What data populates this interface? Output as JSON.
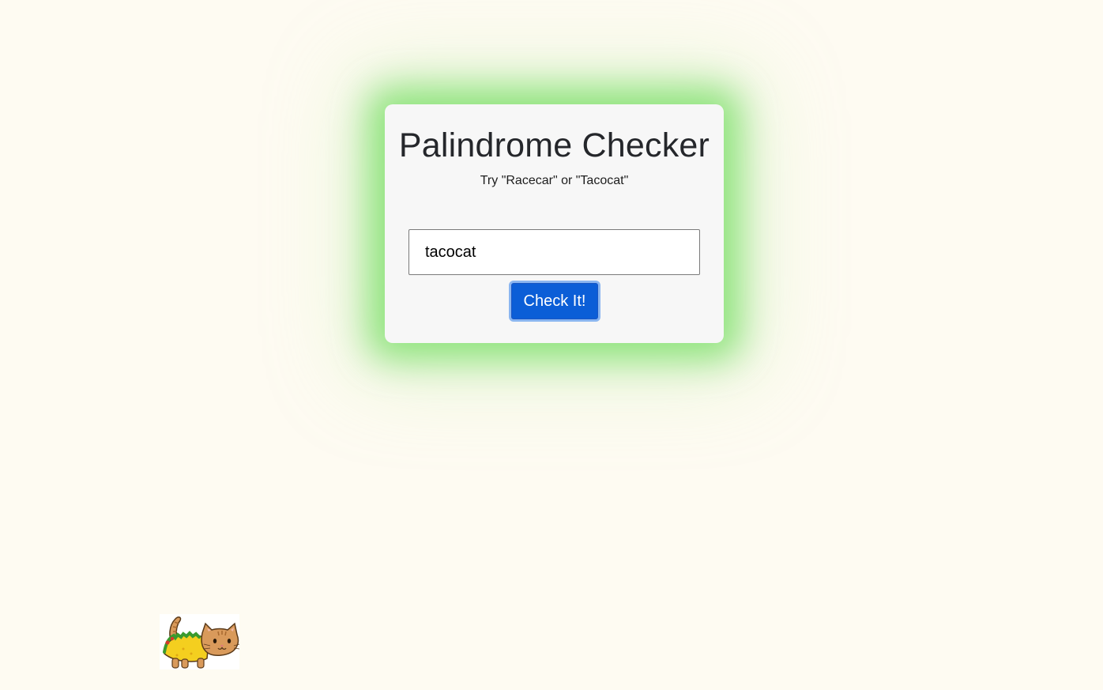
{
  "card": {
    "title": "Palindrome Checker",
    "subtitle": "Try \"Racecar\" or \"Tacocat\""
  },
  "input": {
    "value": "tacocat",
    "placeholder": ""
  },
  "button": {
    "label": "Check It!"
  },
  "image": {
    "icon": "tacocat-icon"
  },
  "colors": {
    "background": "#fefbf2",
    "card": "#f7f7f7",
    "glow": "#6edc5a",
    "button": "#0b5ed7",
    "button_focus_ring": "#8bb6f0"
  }
}
